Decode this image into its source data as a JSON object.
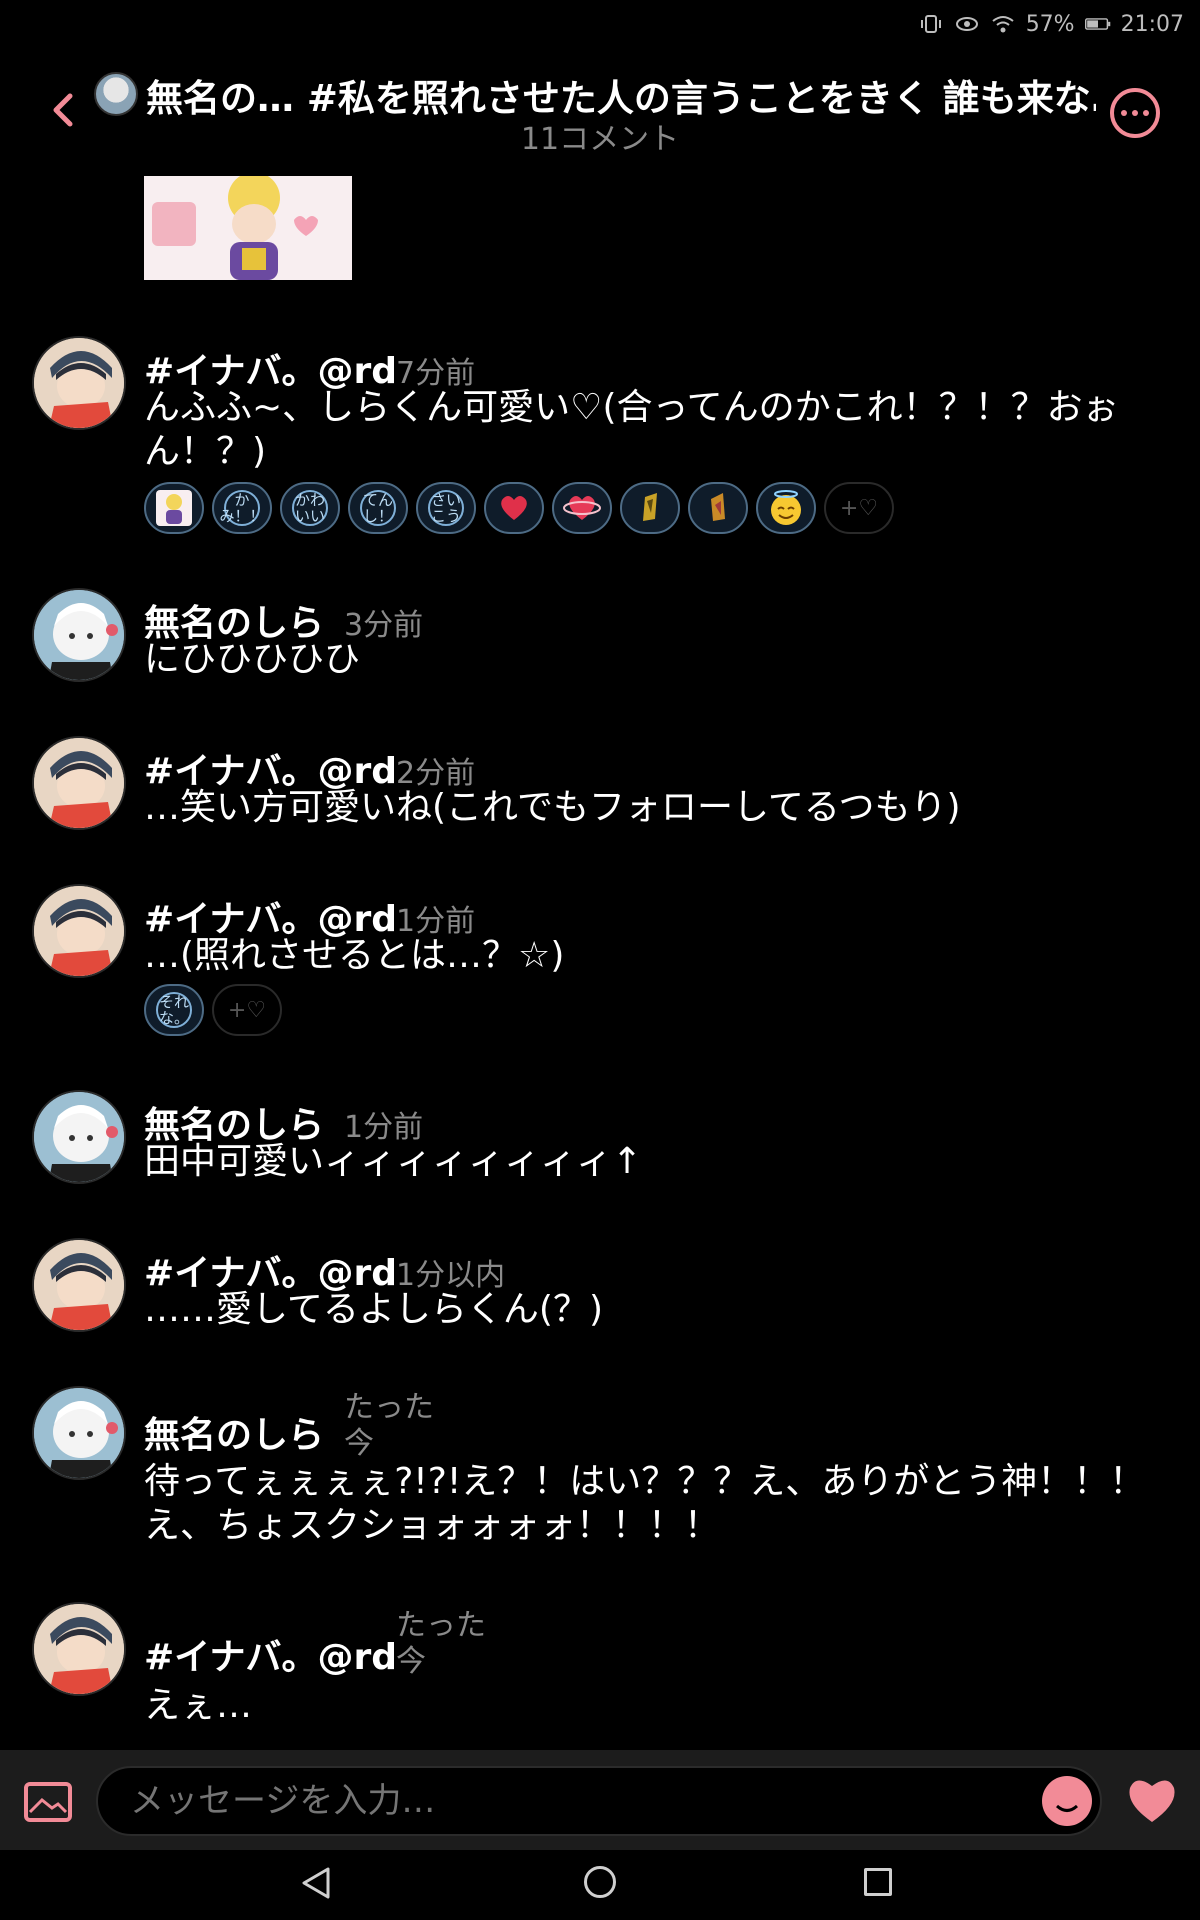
{
  "status": {
    "battery": "57%",
    "time": "21:07"
  },
  "header": {
    "title": "無名の… #私を照れさせた人の言うことをきく 誰も来な…",
    "subtitle": "11コメント"
  },
  "comments": [
    {
      "user": "#イナバ。@rd",
      "time": "7分前",
      "text": "んふふ~、しらくん可愛い♡(合ってんのかこれ！？！？おぉん！？)"
    },
    {
      "user": "無名のしら",
      "time": "3分前",
      "text": "にひひひひひ"
    },
    {
      "user": "#イナバ。@rd",
      "time": "2分前",
      "text": "…笑い方可愛いね(これでもフォローしてるつもり)"
    },
    {
      "user": "#イナバ。@rd",
      "time": "1分前",
      "text": "…(照れさせるとは…？☆)"
    },
    {
      "user": "無名のしら",
      "time": "1分前",
      "text": "田中可愛いィィィィィィィィ↑"
    },
    {
      "user": "#イナバ。@rd",
      "time": "1分以内",
      "text": "……愛してるよしらくん(？)"
    },
    {
      "user": "無名のしら",
      "time": "たった今",
      "text": "待ってぇぇぇぇ?!?!え？！はい？？？え、ありがとう神！！！え、ちょスクショォォォォ！！！！"
    },
    {
      "user": "#イナバ。@rd",
      "time": "たった今",
      "text": "えぇ…"
    }
  ],
  "reactions1": [
    "かみ！！",
    "かわいい",
    "てんし！",
    "さいこう"
  ],
  "reactions2": [
    "それな。"
  ],
  "reaction_add_label": "+♡",
  "input": {
    "placeholder": "メッセージを入力…"
  },
  "colors": {
    "accent": "#f28b97",
    "background": "#000000",
    "muted": "#8a8a8a"
  }
}
